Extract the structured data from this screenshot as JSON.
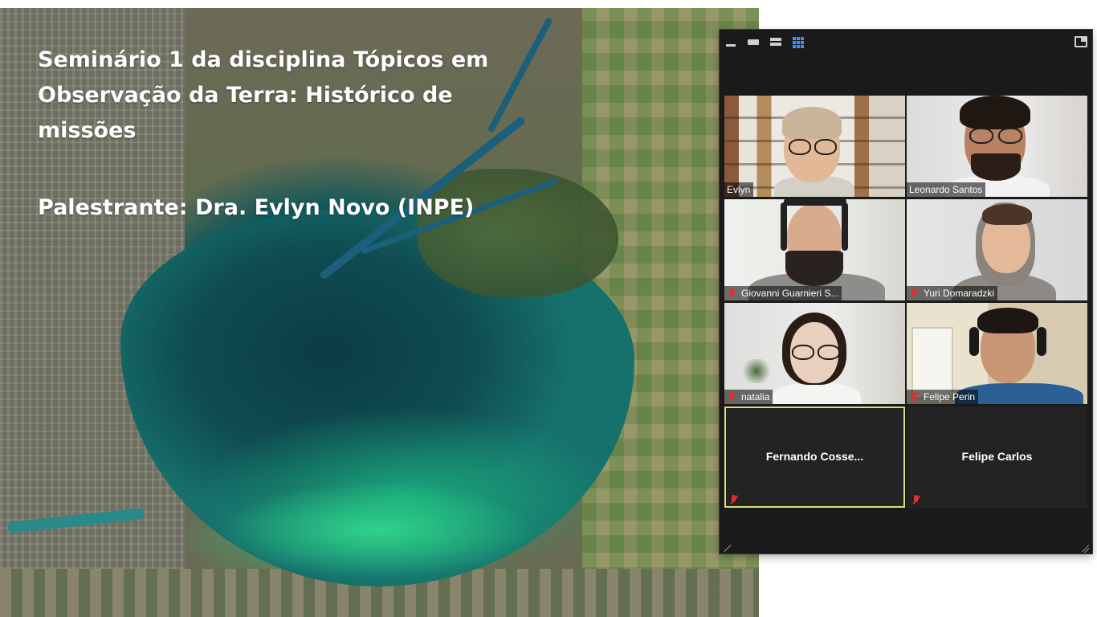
{
  "slide": {
    "title": "Seminário 1 da disciplina Tópicos em Observação da Terra: Histórico de missões",
    "speaker": "Palestrante: Dra. Evlyn Novo (INPE)"
  },
  "gallery_toolbar": {
    "buttons": [
      "minimize-icon",
      "speaker-view-icon",
      "thumbnail-strip-icon",
      "gallery-view-icon",
      "exit-fullscreen-icon"
    ],
    "active_view": "gallery-view-icon",
    "accent_color": "#3e8fff"
  },
  "participants": [
    {
      "name": "Evlyn",
      "muted": false,
      "video": true
    },
    {
      "name": "Leonardo Santos",
      "muted": false,
      "video": true
    },
    {
      "name": "Giovanni Guarnieri S...",
      "muted": true,
      "video": true
    },
    {
      "name": "Yuri Domaradzki",
      "muted": true,
      "video": true
    },
    {
      "name": "natalia",
      "muted": true,
      "video": true
    },
    {
      "name": "Felipe Perin",
      "muted": true,
      "video": true
    },
    {
      "name": "Fernando  Cosse...",
      "muted": true,
      "video": false,
      "active_speaker_outline": "#d7de7a"
    },
    {
      "name": "Felipe Carlos",
      "muted": true,
      "video": false
    }
  ]
}
